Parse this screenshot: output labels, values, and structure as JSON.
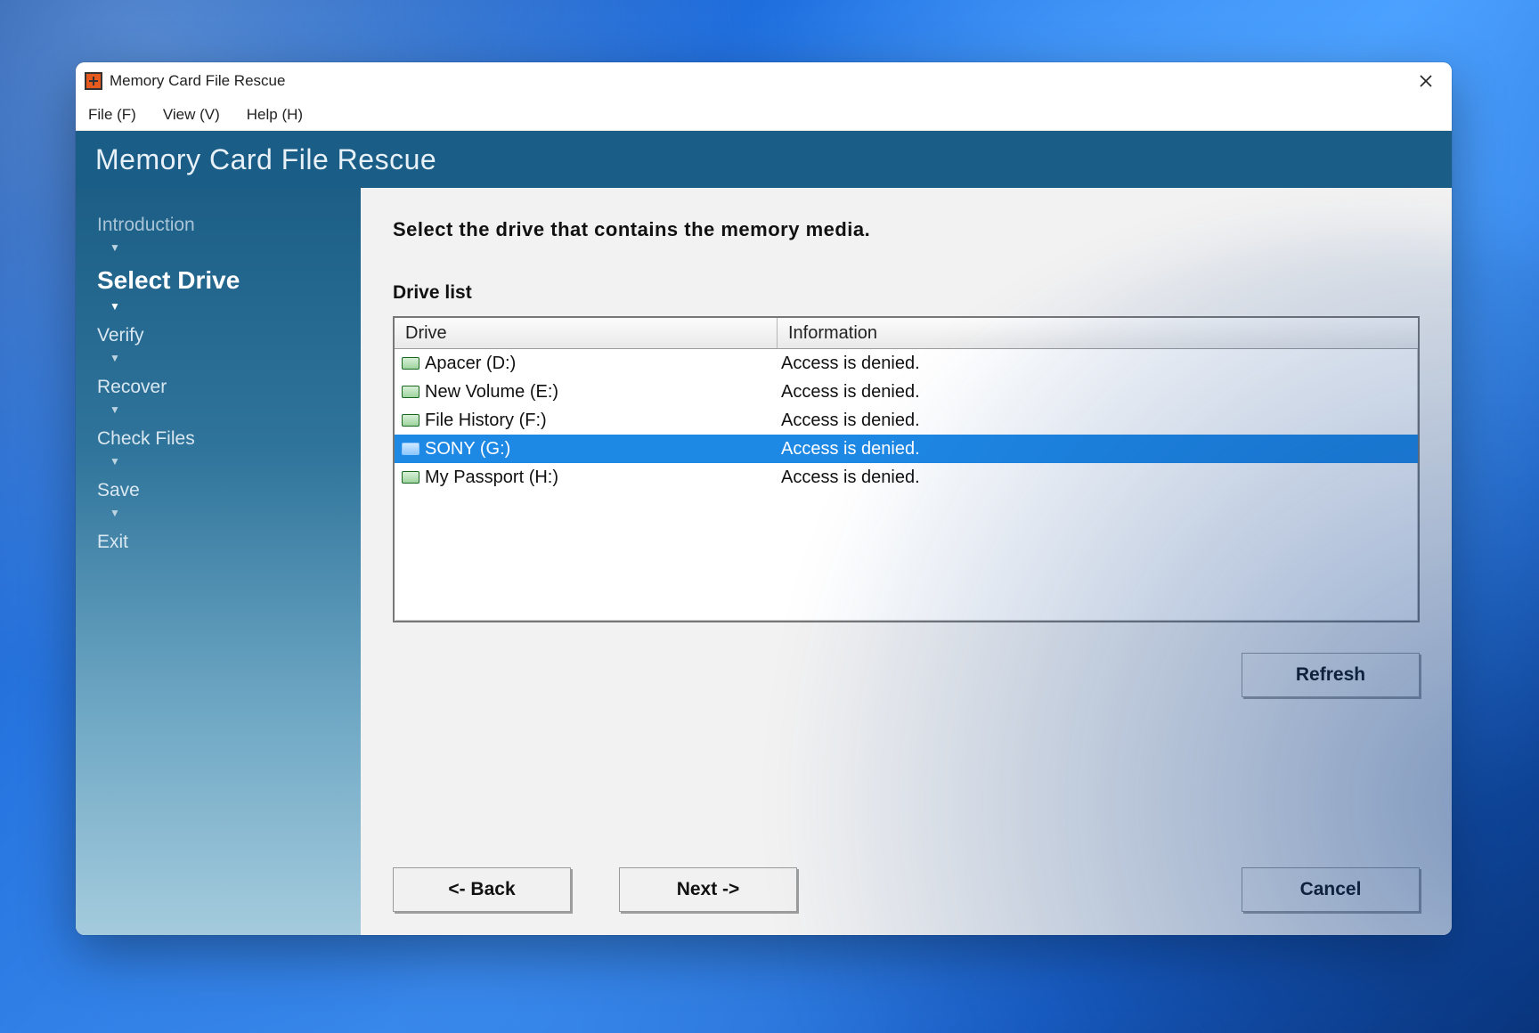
{
  "window": {
    "title": "Memory Card File Rescue"
  },
  "menubar": {
    "file": "File (F)",
    "view": "View (V)",
    "help": "Help (H)"
  },
  "header": {
    "app_title": "Memory Card File Rescue"
  },
  "sidebar": {
    "steps": [
      {
        "label": "Introduction",
        "state": "faded"
      },
      {
        "label": "Select Drive",
        "state": "current"
      },
      {
        "label": "Verify",
        "state": "normal"
      },
      {
        "label": "Recover",
        "state": "normal"
      },
      {
        "label": "Check Files",
        "state": "normal"
      },
      {
        "label": "Save",
        "state": "normal"
      },
      {
        "label": "Exit",
        "state": "normal"
      }
    ]
  },
  "content": {
    "instruction": "Select the drive that contains the memory media.",
    "list_label": "Drive list",
    "columns": {
      "drive": "Drive",
      "info": "Information"
    },
    "rows": [
      {
        "drive": "Apacer (D:)",
        "info": "Access is denied.",
        "selected": false
      },
      {
        "drive": "New Volume (E:)",
        "info": "Access is denied.",
        "selected": false
      },
      {
        "drive": "File History (F:)",
        "info": "Access is denied.",
        "selected": false
      },
      {
        "drive": "SONY (G:)",
        "info": "Access is denied.",
        "selected": true
      },
      {
        "drive": "My Passport (H:)",
        "info": "Access is denied.",
        "selected": false
      }
    ],
    "buttons": {
      "refresh": "Refresh",
      "back": "<- Back",
      "next": "Next ->",
      "cancel": "Cancel"
    }
  }
}
